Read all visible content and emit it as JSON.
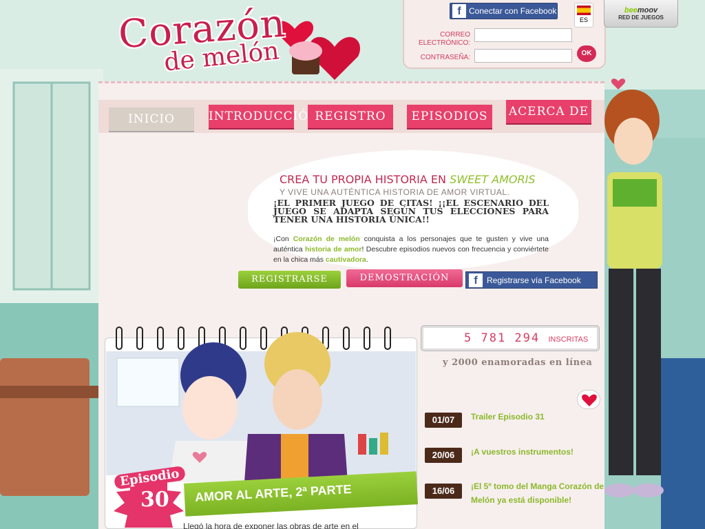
{
  "logo": {
    "title": "Corazón",
    "subtitle": "de melón"
  },
  "login": {
    "facebook_label": "Conectar con Facebook",
    "language_code": "ES",
    "email_label": "CORREO ELECTRÓNICO:",
    "password_label": "CONTRASEÑA:",
    "email_value": "",
    "password_value": "",
    "ok_label": "OK"
  },
  "network": {
    "brand_prefix": "bee",
    "brand_suffix": "moov",
    "label": "RED DE JUEGOS"
  },
  "nav": {
    "items": [
      {
        "label": "INICIO",
        "active": true
      },
      {
        "label": "INTRODUCCIÓN",
        "active": false
      },
      {
        "label": "REGISTRO",
        "active": false
      },
      {
        "label": "EPISODIOS",
        "active": false
      },
      {
        "label": "ACERCA DE",
        "active": false
      }
    ]
  },
  "hero": {
    "line1_prefix": "CREA TU PROPIA HISTORIA EN",
    "line1_game": "SWEET AMORIS",
    "line2": "Y VIVE UNA AUTÉNTICA HISTORIA DE AMOR VIRTUAL.",
    "big": "¡EL PRIMER JUEGO DE CITAS! ¡¡EL ESCENARIO DEL JUEGO SE ADAPTA SEGÚN TUS ELECCIONES PARA TENER UNA HISTORIA ÚNICA!!",
    "text_parts": [
      "¡Con ",
      "Corazón de melón",
      " conquista a los personajes que te gusten y vive una auténtica ",
      "historia de amor",
      "! Descubre episodios nuevos con frecuencia y conviértete en la chica más ",
      "cautivadora",
      "."
    ],
    "register_button": "REGISTRARSE",
    "demo_button": "DEMOSTRACIÓN",
    "facebook_button": "Registrarse vía Facebook"
  },
  "episode": {
    "word": "Episodio",
    "number": "30",
    "title": "AMOR AL ARTE, 2ª PARTE",
    "teaser": "Llegó la hora de exponer las obras de arte en el"
  },
  "stats": {
    "count": "5 781 294",
    "count_label": "INSCRITAS",
    "online": "y 2000 enamoradas en línea"
  },
  "news": [
    {
      "date": "01/07",
      "text": "Trailer Episodio 31"
    },
    {
      "date": "20/06",
      "text": "¡A vuestros instrumentos!"
    },
    {
      "date": "16/06",
      "text": "¡El 5º tomo del Manga Corazón de Melón ya está disponible!"
    }
  ],
  "colors": {
    "brand_pink": "#d83b63",
    "accent_green": "#8cb82c",
    "facebook_blue": "#3b5998"
  }
}
